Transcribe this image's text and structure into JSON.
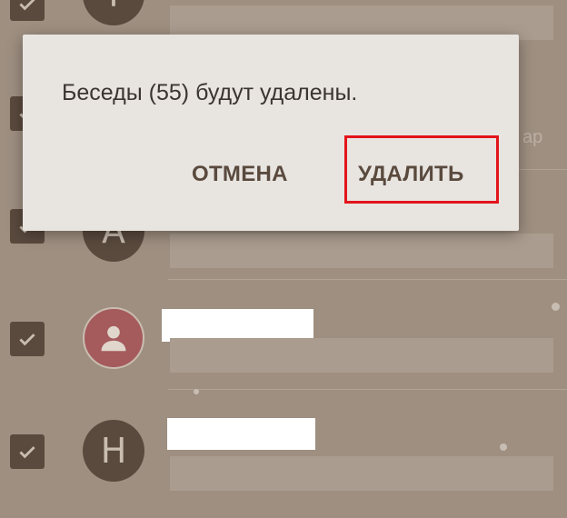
{
  "dialog": {
    "message": "Беседы (55) будут удалены.",
    "cancel_label": "ОТМЕНА",
    "delete_label": "УДАЛИТЬ",
    "highlight_color": "#e3141a"
  },
  "conversations": [
    {
      "avatar_letter": "Т",
      "avatar_kind": "letter",
      "checked": true
    },
    {
      "avatar_letter": "",
      "avatar_kind": "hidden",
      "checked": true,
      "snippet_tail": "ар"
    },
    {
      "avatar_letter": "А",
      "avatar_kind": "letter",
      "checked": true
    },
    {
      "avatar_letter": "",
      "avatar_kind": "person-icon",
      "checked": true
    },
    {
      "avatar_letter": "Н",
      "avatar_kind": "letter",
      "checked": true
    }
  ],
  "colors": {
    "background": "#9e8f80",
    "checkbox": "#5a4a3e",
    "dialog": "#e8e4e0",
    "avatar_red": "#a55a5c"
  }
}
